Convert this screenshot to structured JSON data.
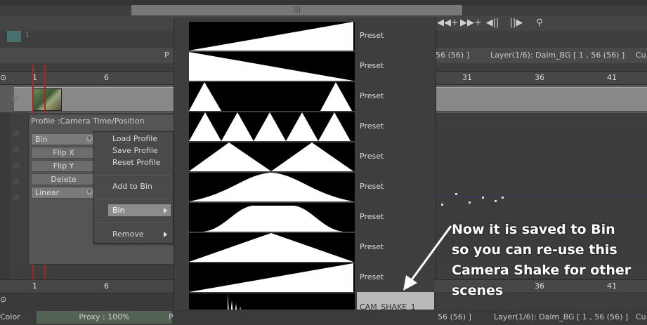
{
  "toolbar": {
    "icons": [
      "prev-key-icon",
      "next-key-icon",
      "step-back-icon",
      "step-forward-icon",
      "location-pin-icon"
    ],
    "glyphs": [
      "◀◀+",
      "▶▶+",
      "◀||",
      "||▶",
      "⚲"
    ],
    "thumb_number": "1",
    "scroll_grip": "|||"
  },
  "info_bar": {
    "left_fragment": "P",
    "frame_fragment": "56  (56) ]",
    "layer_info": "Layer(1/6): Dalm_BG [ 1 , 56  (56) ]",
    "right_fragment": "Cu"
  },
  "ruler_top": {
    "labels": [
      "1",
      "6",
      "31",
      "36",
      "41"
    ]
  },
  "ruler_bottom": {
    "labels": [
      "1",
      "6",
      "36",
      "41"
    ]
  },
  "profile": {
    "title": "Profile :Camera Time/Position",
    "selected_profile": "Bin",
    "buttons": [
      "Flip X",
      "Flip Y",
      "Delete"
    ],
    "interpolation": "Linear"
  },
  "context_menu": {
    "load": "Load Profile",
    "save": "Save Profile",
    "reset": "Reset Profile",
    "add_to_bin": "Add to Bin",
    "bin": "Bin",
    "remove": "Remove"
  },
  "presets": {
    "items": [
      {
        "label": "Preset",
        "shape": "ramp-up"
      },
      {
        "label": "Preset",
        "shape": "ramp-down"
      },
      {
        "label": "Preset",
        "shape": "two-spikes"
      },
      {
        "label": "Preset",
        "shape": "five-triangles"
      },
      {
        "label": "Preset",
        "shape": "two-triangles"
      },
      {
        "label": "Preset",
        "shape": "bell"
      },
      {
        "label": "Preset",
        "shape": "plateau"
      },
      {
        "label": "Preset",
        "shape": "triangle"
      },
      {
        "label": "Preset",
        "shape": "ramp-up-2"
      },
      {
        "label": "CAM_SHAKE_1",
        "shape": "shake"
      }
    ],
    "selected": "CAM_SHAKE_1"
  },
  "status_bar": {
    "color_label": "Color",
    "proxy": "Proxy : 100%",
    "left_fragment": "P",
    "frame_fragment": "56  (56) ]",
    "layer_info": "Layer(1/6): Dalm_BG [ 1 , 56  (56) ]",
    "right_fragment": "Cu"
  },
  "annotation": {
    "lines": [
      "Now it is saved to Bin",
      "so you can re-use this",
      "Camera Shake for other",
      "scenes"
    ]
  },
  "colors": {
    "playhead": "#b82020",
    "selected_preset": "#b9b9b9",
    "graph_line": "#3a3a9a"
  }
}
